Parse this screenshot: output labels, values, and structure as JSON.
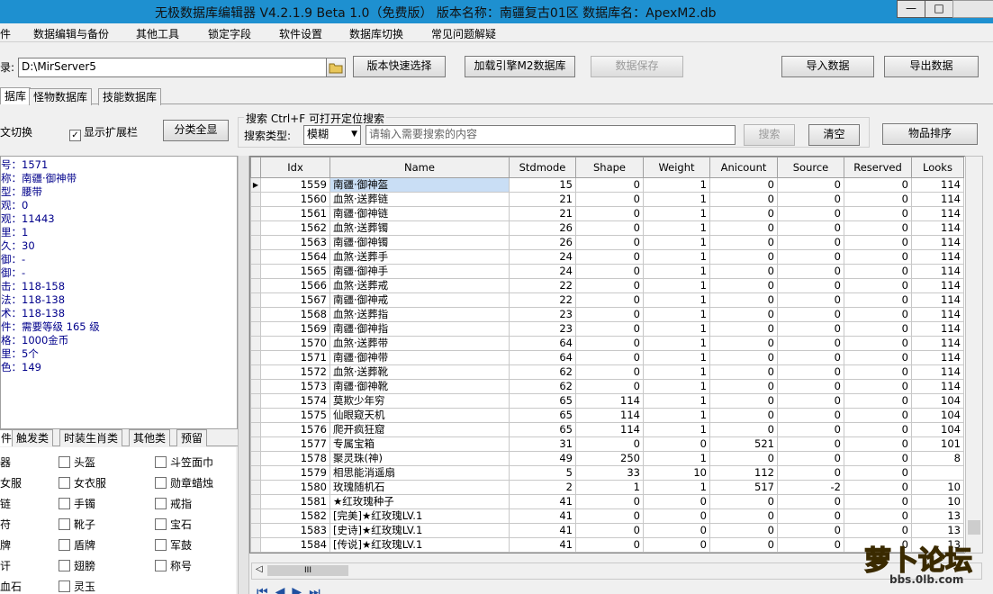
{
  "window": {
    "title": "无极数据库编辑器 V4.2.1.9   Beta 1.0（免费版）   版本名称：南疆复古01区    数据库名：ApexM2.db",
    "min": "—",
    "max": "□"
  },
  "menu": [
    "件",
    "数据编辑与备份",
    "其他工具",
    "锁定字段",
    "软件设置",
    "数据库切换",
    "常见问题解疑"
  ],
  "toolbar": {
    "path_label": "录:",
    "path_value": "D:\\MirServer5",
    "folder_icon": "folder-icon",
    "btn_version": "版本快速选择",
    "btn_load": "加载引擎M2数据库",
    "btn_save": "数据保存",
    "btn_import": "导入数据",
    "btn_export": "导出数据"
  },
  "tabs": [
    "据库",
    "怪物数据库",
    "技能数据库"
  ],
  "options": {
    "switch_label": "文切换",
    "show_ext": "显示扩展栏",
    "show_ext_checked": true,
    "btn_all": "分类全显"
  },
  "search": {
    "title": "搜索   Ctrl+F 可打开定位搜索",
    "type_label": "搜索类型:",
    "type_value": "模糊",
    "placeholder": "请输入需要搜索的内容",
    "btn_search": "搜索",
    "btn_clear": "清空",
    "btn_sort": "物品排序"
  },
  "detail": [
    "号：1571",
    "称：南疆·御神带",
    "型：腰带",
    "观：0",
    "观：11443",
    "里：1",
    "久：30",
    "御：-",
    "御：-",
    "击：118-158",
    "法：118-138",
    "术：118-138",
    "件：需要等级 165 级",
    "格：1000金币",
    "里：5个",
    "色：149"
  ],
  "cat_tabs": [
    "件",
    "触发类",
    "时装生肖类",
    "其他类",
    "预留"
  ],
  "categories": [
    [
      "器",
      "头盔",
      "斗笠面巾"
    ],
    [
      "女服",
      "女衣服",
      "勋章蜡烛"
    ],
    [
      "链",
      "手镯",
      "戒指"
    ],
    [
      "苻",
      "靴子",
      "宝石"
    ],
    [
      "牌",
      "盾牌",
      "军鼓"
    ],
    [
      "讦",
      "翅膀",
      "称号"
    ],
    [
      "血石",
      "灵玉",
      ""
    ]
  ],
  "grid": {
    "columns": [
      "Idx",
      "Name",
      "Stdmode",
      "Shape",
      "Weight",
      "Anicount",
      "Source",
      "Reserved",
      "Looks"
    ],
    "rows": [
      [
        "1559",
        "南疆·御神盔",
        "15",
        "0",
        "1",
        "0",
        "0",
        "0",
        "114"
      ],
      [
        "1560",
        "血煞·送葬链",
        "21",
        "0",
        "1",
        "0",
        "0",
        "0",
        "114"
      ],
      [
        "1561",
        "南疆·御神链",
        "21",
        "0",
        "1",
        "0",
        "0",
        "0",
        "114"
      ],
      [
        "1562",
        "血煞·送葬镯",
        "26",
        "0",
        "1",
        "0",
        "0",
        "0",
        "114"
      ],
      [
        "1563",
        "南疆·御神镯",
        "26",
        "0",
        "1",
        "0",
        "0",
        "0",
        "114"
      ],
      [
        "1564",
        "血煞·送葬手",
        "24",
        "0",
        "1",
        "0",
        "0",
        "0",
        "114"
      ],
      [
        "1565",
        "南疆·御神手",
        "24",
        "0",
        "1",
        "0",
        "0",
        "0",
        "114"
      ],
      [
        "1566",
        "血煞·送葬戒",
        "22",
        "0",
        "1",
        "0",
        "0",
        "0",
        "114"
      ],
      [
        "1567",
        "南疆·御神戒",
        "22",
        "0",
        "1",
        "0",
        "0",
        "0",
        "114"
      ],
      [
        "1568",
        "血煞·送葬指",
        "23",
        "0",
        "1",
        "0",
        "0",
        "0",
        "114"
      ],
      [
        "1569",
        "南疆·御神指",
        "23",
        "0",
        "1",
        "0",
        "0",
        "0",
        "114"
      ],
      [
        "1570",
        "血煞·送葬带",
        "64",
        "0",
        "1",
        "0",
        "0",
        "0",
        "114"
      ],
      [
        "1571",
        "南疆·御神带",
        "64",
        "0",
        "1",
        "0",
        "0",
        "0",
        "114"
      ],
      [
        "1572",
        "血煞·送葬靴",
        "62",
        "0",
        "1",
        "0",
        "0",
        "0",
        "114"
      ],
      [
        "1573",
        "南疆·御神靴",
        "62",
        "0",
        "1",
        "0",
        "0",
        "0",
        "114"
      ],
      [
        "1574",
        "莫欺少年穷",
        "65",
        "114",
        "1",
        "0",
        "0",
        "0",
        "104"
      ],
      [
        "1575",
        "仙眼窥天机",
        "65",
        "114",
        "1",
        "0",
        "0",
        "0",
        "104"
      ],
      [
        "1576",
        "爬开疯狂窟",
        "65",
        "114",
        "1",
        "0",
        "0",
        "0",
        "104"
      ],
      [
        "1577",
        "专属宝箱",
        "31",
        "0",
        "0",
        "521",
        "0",
        "0",
        "101"
      ],
      [
        "1578",
        "聚灵珠(神)",
        "49",
        "250",
        "1",
        "0",
        "0",
        "0",
        "8"
      ],
      [
        "1579",
        "相思能消遥扇",
        "5",
        "33",
        "10",
        "112",
        "0",
        "0",
        ""
      ],
      [
        "1580",
        "玫瑰随机石",
        "2",
        "1",
        "1",
        "517",
        "-2",
        "0",
        "10"
      ],
      [
        "1581",
        "★红玫瑰种子",
        "41",
        "0",
        "0",
        "0",
        "0",
        "0",
        "10"
      ],
      [
        "1582",
        "[完美]★红玫瑰LV.1",
        "41",
        "0",
        "0",
        "0",
        "0",
        "0",
        "13"
      ],
      [
        "1583",
        "[史诗]★红玫瑰LV.1",
        "41",
        "0",
        "0",
        "0",
        "0",
        "0",
        "13"
      ],
      [
        "1584",
        "[传说]★红玫瑰LV.1",
        "41",
        "0",
        "0",
        "0",
        "0",
        "0",
        "13"
      ]
    ]
  },
  "hscroll_thumb": "III",
  "watermark": {
    "text": "萝卜论坛",
    "url": "bbs.0lb.com"
  }
}
